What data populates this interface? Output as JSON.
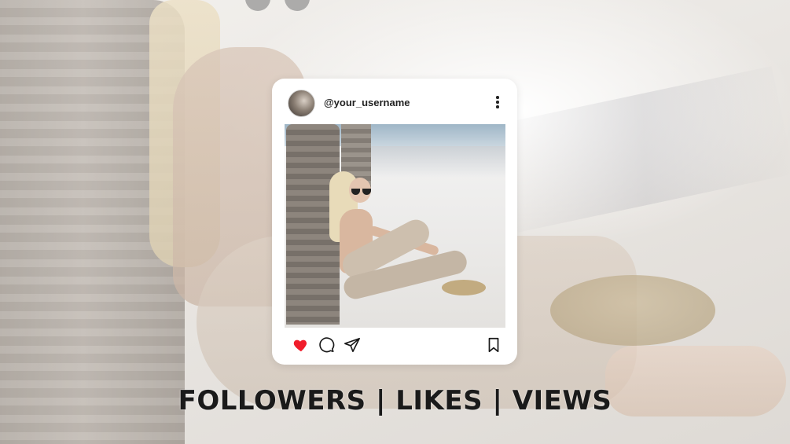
{
  "post": {
    "username": "@your_username",
    "liked": true
  },
  "caption": {
    "text": "FOLLOWERS | LIKES | VIEWS"
  },
  "colors": {
    "heart": "#f01d2b",
    "card_bg": "#ffffff",
    "text": "#1a1a1a"
  },
  "icons": {
    "more": "more-vertical-icon",
    "like": "heart-icon",
    "comment": "comment-icon",
    "share": "send-icon",
    "save": "bookmark-icon"
  }
}
